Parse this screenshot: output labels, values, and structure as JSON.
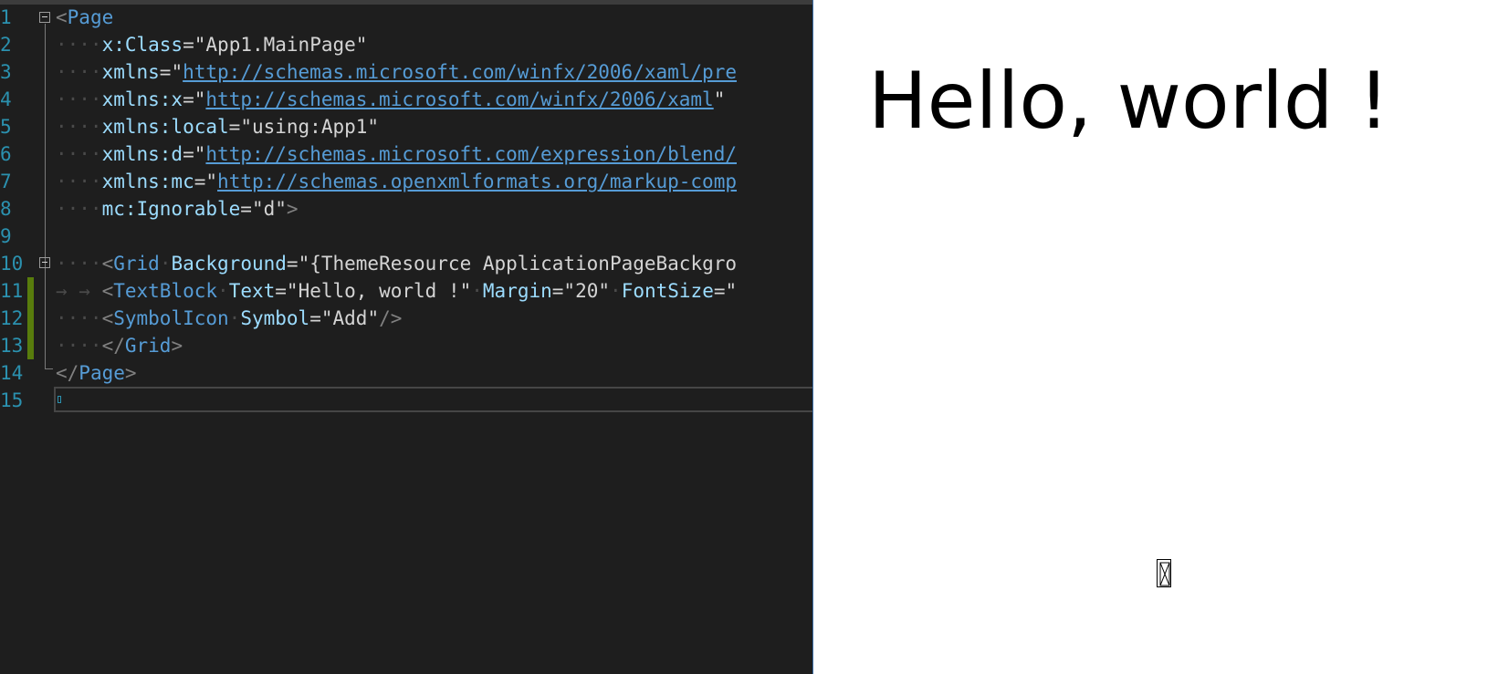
{
  "editor": {
    "line_numbers": [
      "1",
      "2",
      "3",
      "4",
      "5",
      "6",
      "7",
      "8",
      "9",
      "10",
      "11",
      "12",
      "13",
      "14",
      "15"
    ],
    "lines": {
      "l1": {
        "tag": "Page"
      },
      "l2": {
        "attr": "x:Class",
        "val": "App1.MainPage"
      },
      "l3": {
        "attr": "xmlns",
        "url": "http://schemas.microsoft.com/winfx/2006/xaml/pre"
      },
      "l4": {
        "attr": "xmlns:x",
        "url": "http://schemas.microsoft.com/winfx/2006/xaml"
      },
      "l5": {
        "attr": "xmlns:local",
        "val": "using:App1"
      },
      "l6": {
        "attr": "xmlns:d",
        "url": "http://schemas.microsoft.com/expression/blend/"
      },
      "l7": {
        "attr": "xmlns:mc",
        "url": "http://schemas.openxmlformats.org/markup-comp"
      },
      "l8": {
        "attr": "mc:Ignorable",
        "val": "d"
      },
      "l10": {
        "tag": "Grid",
        "attr": "Background",
        "val": "{ThemeResource ApplicationPageBackgro"
      },
      "l11": {
        "tag": "TextBlock",
        "attr1": "Text",
        "val1": "Hello, world !",
        "attr2": "Margin",
        "val2": "20",
        "attr3": "FontSize",
        "val3": ""
      },
      "l12": {
        "tag": "SymbolIcon",
        "attr": "Symbol",
        "val": "Add"
      },
      "l13": {
        "tag": "Grid"
      },
      "l14": {
        "tag": "Page"
      }
    }
  },
  "preview": {
    "hello_text": "Hello, world !",
    "symbol_icon": "missing-glyph-icon"
  },
  "colors": {
    "editor_bg": "#1e1e1e",
    "tag": "#569cd6",
    "attribute": "#9cdcfe",
    "line_number": "#2b91af",
    "changed_bar": "#587c0c"
  }
}
